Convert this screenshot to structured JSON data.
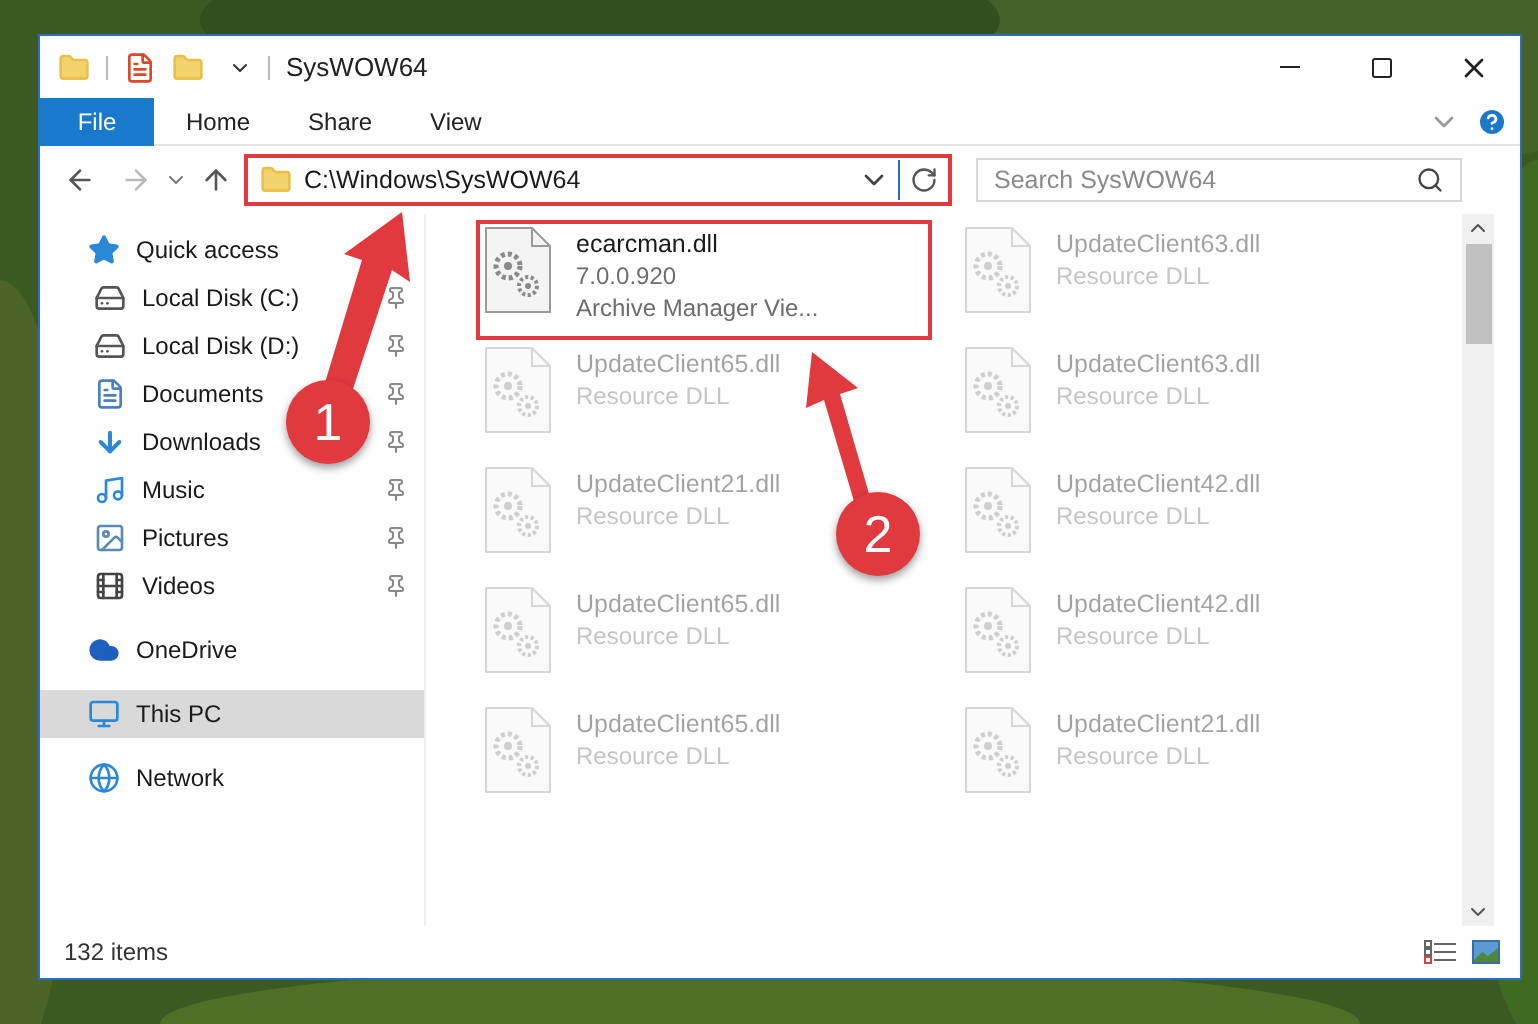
{
  "window": {
    "title": "SysWOW64"
  },
  "ribbon_tabs": [
    {
      "label": "File",
      "kind": "file"
    },
    {
      "label": "Home",
      "kind": "tab"
    },
    {
      "label": "Share",
      "kind": "tab"
    },
    {
      "label": "View",
      "kind": "tab"
    }
  ],
  "address": {
    "path": "C:\\Windows\\SysWOW64",
    "highlighted": true
  },
  "search": {
    "placeholder": "Search SysWOW64"
  },
  "sidebar": {
    "items": [
      {
        "label": "Quick access",
        "kind": "star",
        "selected": false,
        "children": [
          {
            "label": "Local Disk (C:)",
            "kind": "drive-c",
            "pinned": true
          },
          {
            "label": "Local Disk (D:)",
            "kind": "drive",
            "pinned": true
          },
          {
            "label": "Documents",
            "kind": "documents",
            "pinned": true
          },
          {
            "label": "Downloads",
            "kind": "downloads",
            "pinned": true
          },
          {
            "label": "Music",
            "kind": "music",
            "pinned": true
          },
          {
            "label": "Pictures",
            "kind": "pictures",
            "pinned": true
          },
          {
            "label": "Videos",
            "kind": "videos",
            "pinned": true
          }
        ]
      },
      {
        "label": "OneDrive",
        "kind": "cloud",
        "selected": false
      },
      {
        "label": "This PC",
        "kind": "pc",
        "selected": true
      },
      {
        "label": "Network",
        "kind": "network",
        "selected": false
      }
    ]
  },
  "files": [
    {
      "name": "ecarcman.dll",
      "lines": [
        "7.0.0.920",
        "Archive Manager Vie..."
      ],
      "highlighted": true
    },
    {
      "name": "UpdateClient63.dll",
      "lines": [
        "Resource DLL"
      ],
      "highlighted": false
    },
    {
      "name": "UpdateClient65.dll",
      "lines": [
        "Resource DLL"
      ],
      "highlighted": false
    },
    {
      "name": "UpdateClient63.dll",
      "lines": [
        "Resource DLL"
      ],
      "highlighted": false
    },
    {
      "name": "UpdateClient21.dll",
      "lines": [
        "Resource DLL"
      ],
      "highlighted": false
    },
    {
      "name": "UpdateClient42.dll",
      "lines": [
        "Resource DLL"
      ],
      "highlighted": false
    },
    {
      "name": "UpdateClient65.dll",
      "lines": [
        "Resource DLL"
      ],
      "highlighted": false
    },
    {
      "name": "UpdateClient42.dll",
      "lines": [
        "Resource DLL"
      ],
      "highlighted": false
    },
    {
      "name": "UpdateClient65.dll",
      "lines": [
        "Resource DLL"
      ],
      "highlighted": false
    },
    {
      "name": "UpdateClient21.dll",
      "lines": [
        "Resource DLL"
      ],
      "highlighted": false
    }
  ],
  "status_bar": {
    "count": "132 items"
  },
  "annotations": [
    {
      "number": "1"
    },
    {
      "number": "2"
    }
  ]
}
